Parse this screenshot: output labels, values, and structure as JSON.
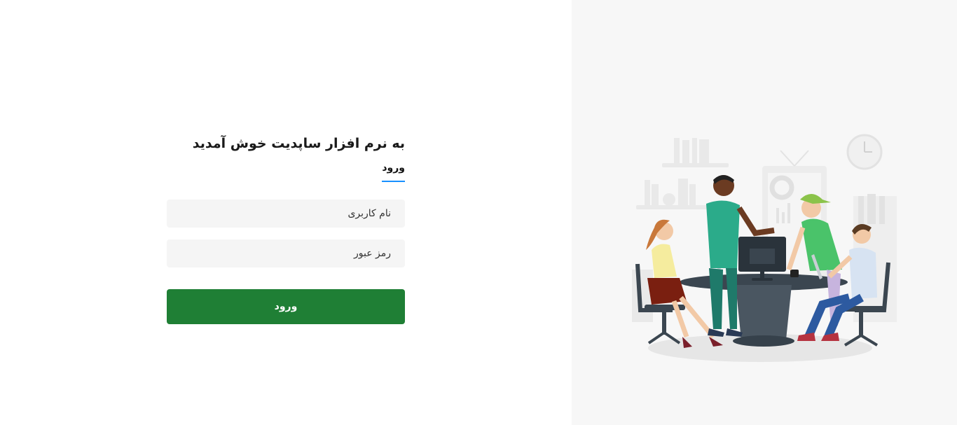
{
  "login": {
    "title": "به نرم افزار ساپدیت خوش آمدید",
    "tab_label": "ورود",
    "username_placeholder": "نام کاربری",
    "password_placeholder": "رمز عبور",
    "submit_label": "ورود"
  },
  "colors": {
    "accent": "#1890ff",
    "submit": "#1f7f35",
    "input_bg": "#f5f5f5",
    "right_bg": "#f7f7f7"
  },
  "illustration": {
    "icon": "office-team-illustration"
  }
}
